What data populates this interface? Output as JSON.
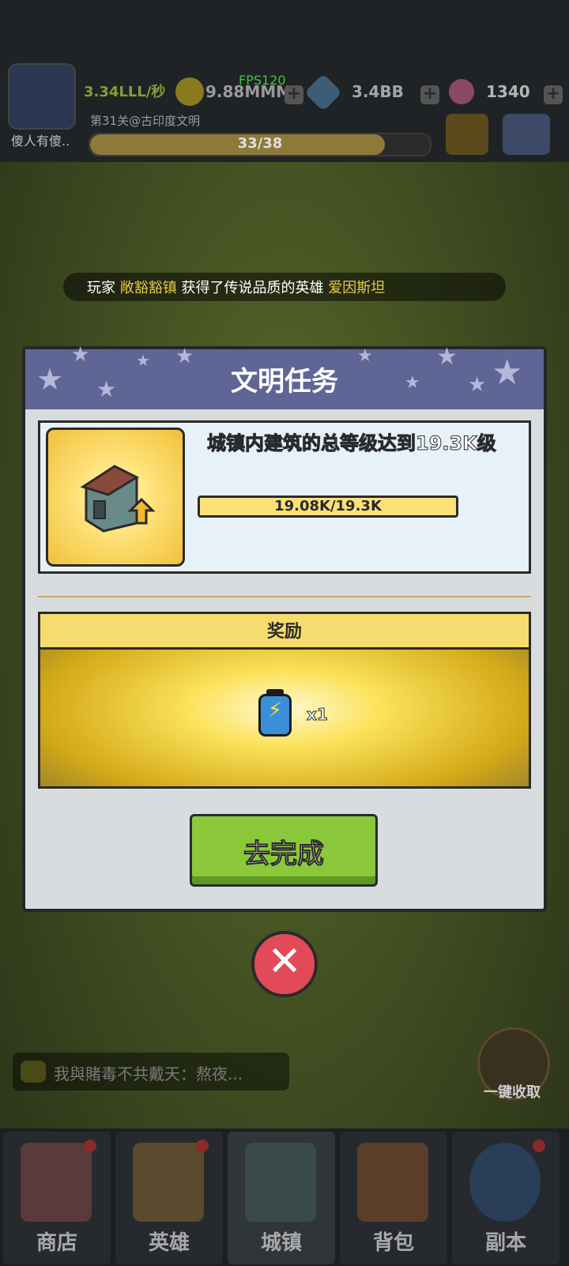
{
  "hud": {
    "player_name": "傻人有傻..",
    "income": "3.34LLL/秒",
    "fps": "FPS120",
    "crown_value": "9.88MMM",
    "gem_value": "3.4BB",
    "candy_value": "1340",
    "stage": "第31关@古印度文明",
    "progress_text": "33/38",
    "progress_fraction": 0.868
  },
  "announcement": {
    "prefix": "玩家",
    "player": "敞豁豁镇",
    "middle": "获得了传说品质的英雄",
    "hero": "爱因斯坦"
  },
  "modal": {
    "title": "文明任务",
    "task_description": "城镇内建筑的总等级达到19.3K级",
    "task_progress_text": "19.08K/19.3K",
    "task_progress_fraction": 0.989,
    "reward_header": "奖励",
    "reward_item_icon": "battery-icon",
    "reward_quantity": "x1",
    "go_button": "去完成",
    "close_icon": "close-icon"
  },
  "chat": {
    "preview": "我與賭毒不共戴天：熬夜..."
  },
  "collect_button": "一键收取",
  "nav": {
    "items": [
      {
        "label": "商店",
        "icon": "shop-icon"
      },
      {
        "label": "英雄",
        "icon": "hero-icon"
      },
      {
        "label": "城镇",
        "icon": "town-icon"
      },
      {
        "label": "背包",
        "icon": "backpack-icon"
      },
      {
        "label": "副本",
        "icon": "globe-icon"
      }
    ]
  },
  "colors": {
    "modal_header": "#5f6594",
    "go_button": "#8bc83a",
    "close_button": "#e24a5a",
    "progress_fill": "#fbe07a"
  }
}
